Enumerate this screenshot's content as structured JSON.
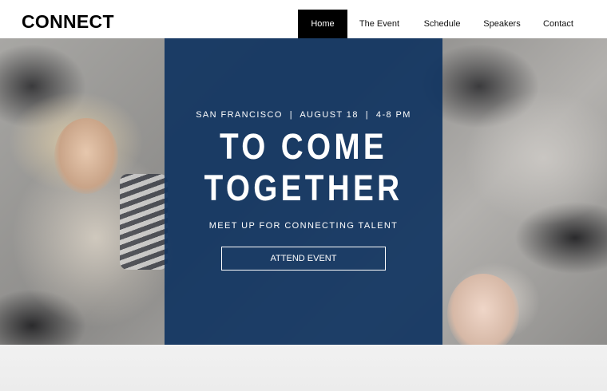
{
  "header": {
    "logo": "CONNECT",
    "nav": [
      {
        "label": "Home",
        "active": true
      },
      {
        "label": "The Event",
        "active": false
      },
      {
        "label": "Schedule",
        "active": false
      },
      {
        "label": "Speakers",
        "active": false
      },
      {
        "label": "Contact",
        "active": false
      }
    ]
  },
  "hero": {
    "meta": "SAN FRANCISCO  |  AUGUST 18  |  4-8 PM",
    "headline_line1": "TO COME",
    "headline_line2": "TOGETHER",
    "tagline": "MEET UP FOR CONNECTING TALENT",
    "cta_label": "ATTEND EVENT"
  },
  "colors": {
    "panel": "#103461",
    "nav_active_bg": "#000000",
    "text_light": "#ffffff"
  }
}
